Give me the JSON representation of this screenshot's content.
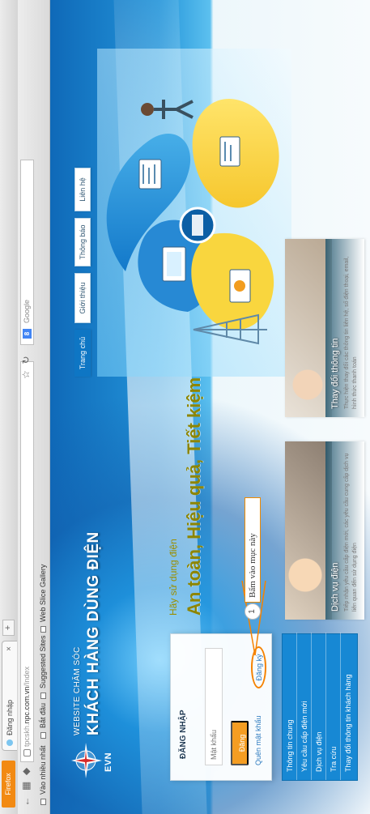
{
  "browser": {
    "menu_label": "Firefox",
    "tab_title": "Đăng nhập",
    "new_tab_symbol": "+",
    "url_prefix": "tpcskh.",
    "url_domain": "npc.com.vn",
    "url_suffix": "/Index",
    "search_placeholder": "Google",
    "bookmarks": [
      {
        "label": "Vào nhiều nhất"
      },
      {
        "label": "Bắt đầu"
      },
      {
        "label": "Suggested Sites"
      },
      {
        "label": "Web Slice Gallery"
      }
    ]
  },
  "site": {
    "logo_text": "EVN",
    "title_top": "WEBSITE CHĂM SÓC",
    "title_main": "KHÁCH HÀNG DÙNG ĐIỆN",
    "nav": [
      {
        "label": "Trang chủ",
        "active": true
      },
      {
        "label": "Giới thiệu",
        "active": false
      },
      {
        "label": "Thông báo",
        "active": false
      },
      {
        "label": "Liên hệ",
        "active": false
      }
    ],
    "login": {
      "title": "ĐĂNG NHẬP",
      "password_placeholder": "Mật khẩu",
      "login_button": "Đăng nhập",
      "forgot_password": "Quên mật khẩu",
      "register": "Đăng ký"
    },
    "side_menu": [
      {
        "label": "Thông tin chung"
      },
      {
        "label": "Yêu cầu cấp điện mới"
      },
      {
        "label": "Dịch vụ điện"
      },
      {
        "label": "Tra cứu"
      },
      {
        "label": "Thay đổi thông tin khách hàng"
      }
    ],
    "banner": {
      "subtitle": "Hãy sử dụng điện",
      "slogan": "An toàn, Hiệu quả, Tiết kiệm"
    },
    "annotation": {
      "marker": "1",
      "hint": "Bấm vào mục này"
    },
    "cards": [
      {
        "title": "Dịch vụ điện",
        "description": "Tiếp nhận yêu cầu cấp điện mới, các yêu cầu cung cấp dịch vụ liên quan đến sử dụng điện"
      },
      {
        "title": "Thay đổi thông tin",
        "description": "Thực hiện thay đổi các thông tin liên hệ, số điện thoại, email, hình thức thanh toán"
      }
    ]
  },
  "colors": {
    "accent_orange": "#f58200",
    "evn_blue": "#0e76c4",
    "slogan_yellow": "#8d8500"
  }
}
